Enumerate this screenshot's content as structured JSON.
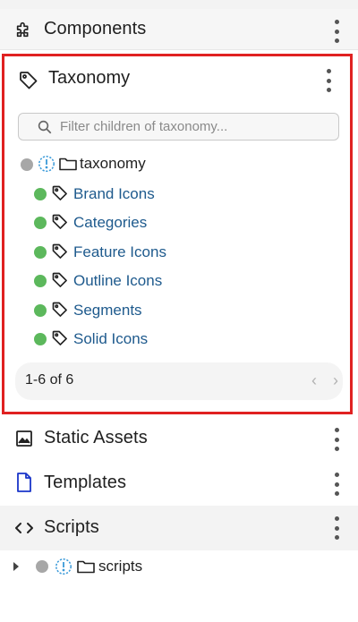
{
  "sections": {
    "components": {
      "title": "Components",
      "icon": "puzzle-icon"
    },
    "taxonomy": {
      "title": "Taxonomy",
      "icon": "tag-icon",
      "filter_placeholder": "Filter children of taxonomy...",
      "root": {
        "label": "taxonomy",
        "status": "gray"
      },
      "children": [
        {
          "label": "Brand Icons",
          "status": "green"
        },
        {
          "label": "Categories",
          "status": "green"
        },
        {
          "label": "Feature Icons",
          "status": "green"
        },
        {
          "label": "Outline Icons",
          "status": "green"
        },
        {
          "label": "Segments",
          "status": "green"
        },
        {
          "label": "Solid Icons",
          "status": "green"
        }
      ],
      "pagination": "1-6 of 6"
    },
    "static_assets": {
      "title": "Static Assets",
      "icon": "image-icon"
    },
    "templates": {
      "title": "Templates",
      "icon": "file-icon"
    },
    "scripts": {
      "title": "Scripts",
      "icon": "code-icon",
      "root": {
        "label": "scripts",
        "status": "gray"
      }
    }
  },
  "colors": {
    "highlight_border": "#e02121",
    "link": "#1e5a8d",
    "status_green": "#5cb85c",
    "status_gray": "#a7a7a7",
    "info_blue": "#3a9ad9"
  }
}
